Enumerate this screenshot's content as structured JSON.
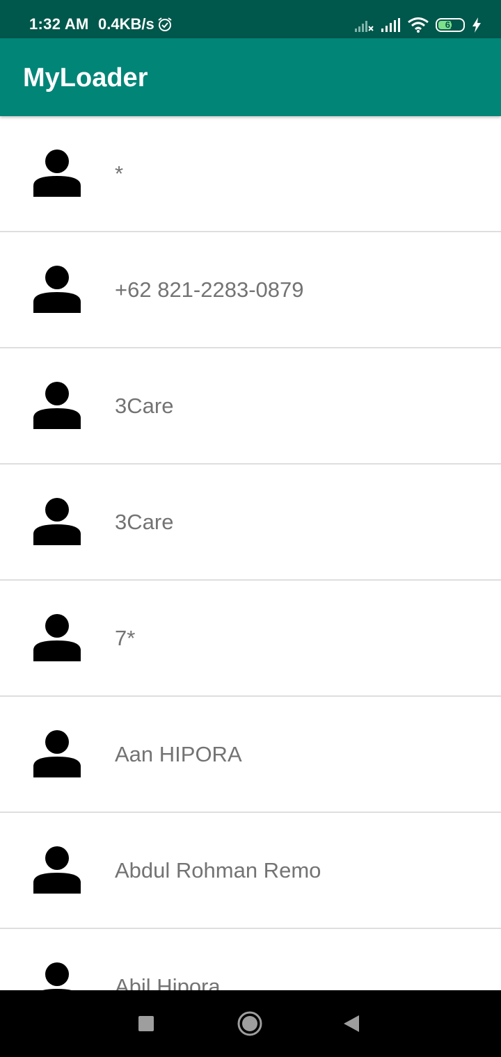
{
  "status_bar": {
    "time": "1:32 AM",
    "network_speed": "0.4KB/s",
    "battery_level": "61",
    "battery_fraction": 0.61,
    "icons": [
      "alarm-icon",
      "no-signal-icon",
      "signal-icon",
      "wifi-icon",
      "battery-icon",
      "charging-icon"
    ]
  },
  "app_bar": {
    "title": "MyLoader",
    "color": "#008577",
    "status_color": "#00574b"
  },
  "contacts": [
    {
      "name": "*",
      "icon": "person-icon"
    },
    {
      "name": "+62 821-2283-0879",
      "icon": "person-icon"
    },
    {
      "name": "3Care",
      "icon": "person-icon"
    },
    {
      "name": "3Care",
      "icon": "person-icon"
    },
    {
      "name": "7*",
      "icon": "person-icon"
    },
    {
      "name": "Aan HIPORA",
      "icon": "person-icon"
    },
    {
      "name": "Abdul Rohman Remo",
      "icon": "person-icon"
    },
    {
      "name": "Abil Hipora",
      "icon": "person-icon"
    }
  ],
  "nav_bar": {
    "buttons": [
      "recents-button",
      "home-button",
      "back-button"
    ]
  }
}
